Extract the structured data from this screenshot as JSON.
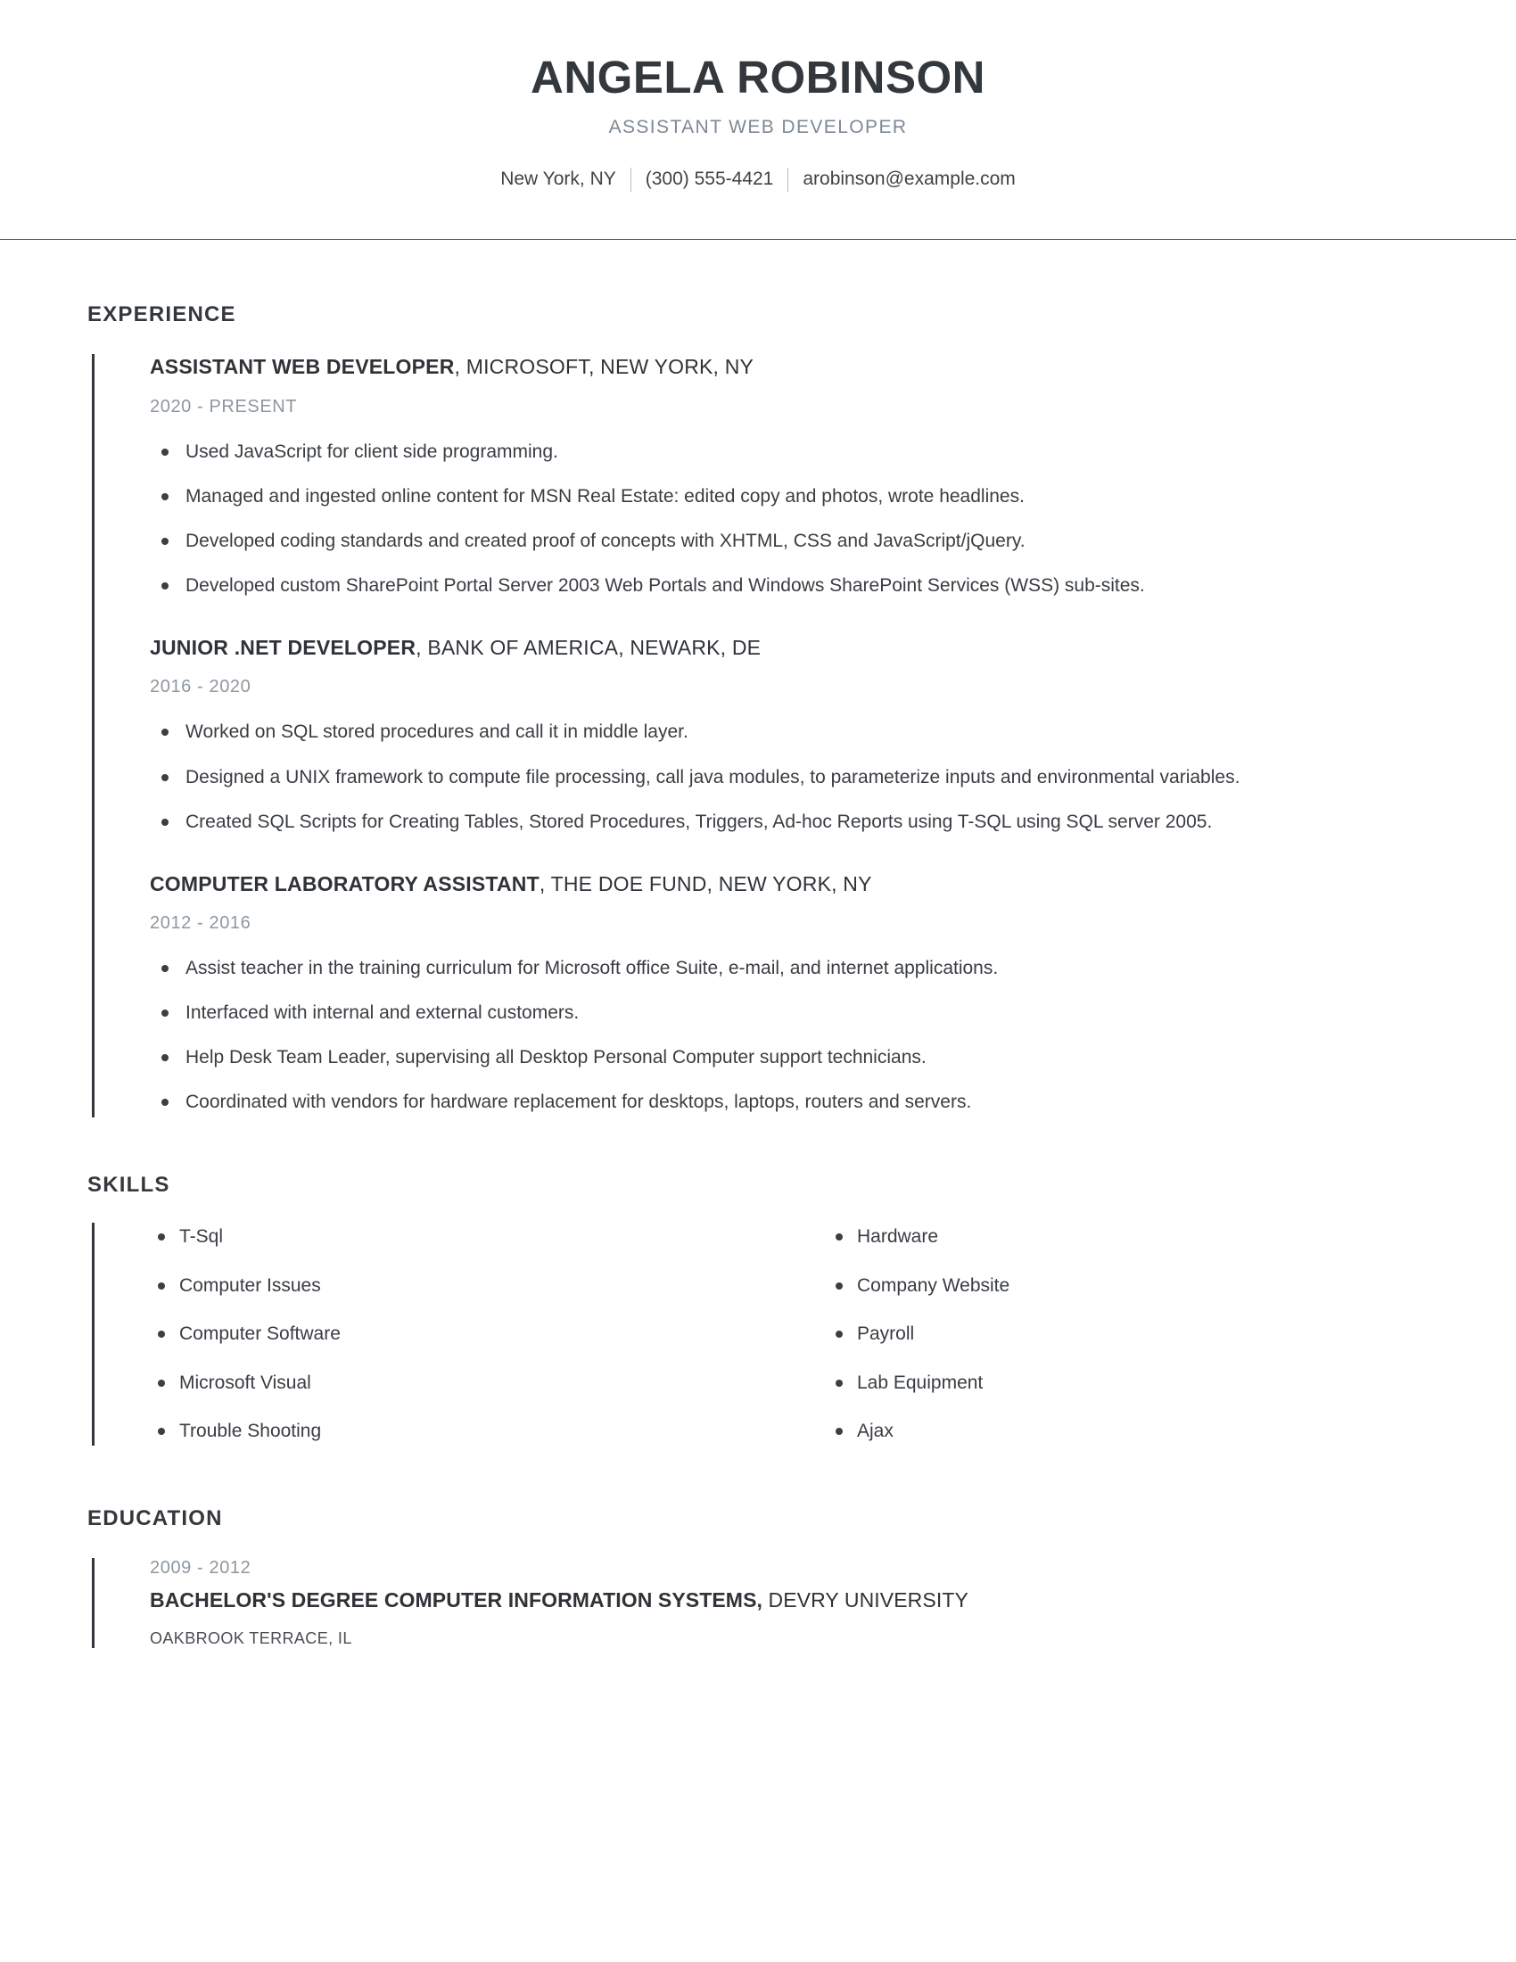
{
  "header": {
    "full_name": "ANGELA ROBINSON",
    "job_subtitle": "ASSISTANT WEB DEVELOPER",
    "contact": {
      "location": "New York, NY",
      "phone": "(300) 555-4421",
      "email": "arobinson@example.com"
    }
  },
  "sections": {
    "experience_title": "EXPERIENCE",
    "skills_title": "SKILLS",
    "education_title": "EDUCATION"
  },
  "experience": [
    {
      "role": "ASSISTANT WEB DEVELOPER",
      "company": ", MICROSOFT, NEW YORK, NY",
      "dates": "2020 - PRESENT",
      "bullets": [
        "Used JavaScript for client side programming.",
        "Managed and ingested online content for MSN Real Estate: edited copy and photos, wrote headlines.",
        "Developed coding standards and created proof of concepts with XHTML, CSS and JavaScript/jQuery.",
        "Developed custom SharePoint Portal Server 2003 Web Portals and Windows SharePoint Services (WSS) sub-sites."
      ]
    },
    {
      "role": "JUNIOR .NET DEVELOPER",
      "company": ", BANK OF AMERICA, NEWARK, DE",
      "dates": "2016 - 2020",
      "bullets": [
        "Worked on SQL stored procedures and call it in middle layer.",
        "Designed a UNIX framework to compute file processing, call java modules, to parameterize inputs and environmental variables.",
        "Created SQL Scripts for Creating Tables, Stored Procedures, Triggers, Ad-hoc Reports using T-SQL using SQL server 2005."
      ]
    },
    {
      "role": "COMPUTER LABORATORY ASSISTANT",
      "company": ", THE DOE FUND, NEW YORK, NY",
      "dates": "2012 - 2016",
      "bullets": [
        "Assist teacher in the training curriculum for Microsoft office Suite, e-mail, and internet applications.",
        "Interfaced with internal and external customers.",
        "Help Desk Team Leader, supervising all Desktop Personal Computer support technicians.",
        "Coordinated with vendors for hardware replacement for desktops, laptops, routers and servers."
      ]
    }
  ],
  "skills": {
    "left": [
      "T-Sql",
      "Computer Issues",
      "Computer Software",
      "Microsoft Visual",
      "Trouble Shooting"
    ],
    "right": [
      "Hardware",
      "Company Website",
      "Payroll",
      "Lab Equipment",
      "Ajax"
    ]
  },
  "education": [
    {
      "dates": "2009 - 2012",
      "degree": "BACHELOR'S DEGREE COMPUTER INFORMATION SYSTEMS,",
      "school": " DEVRY UNIVERSITY",
      "location": "OAKBROOK TERRACE, IL"
    }
  ],
  "colors": {
    "text_dark": "#33383d",
    "text_muted": "#8e979f",
    "accent_bar": "#34383d",
    "rule": "#555a60"
  }
}
